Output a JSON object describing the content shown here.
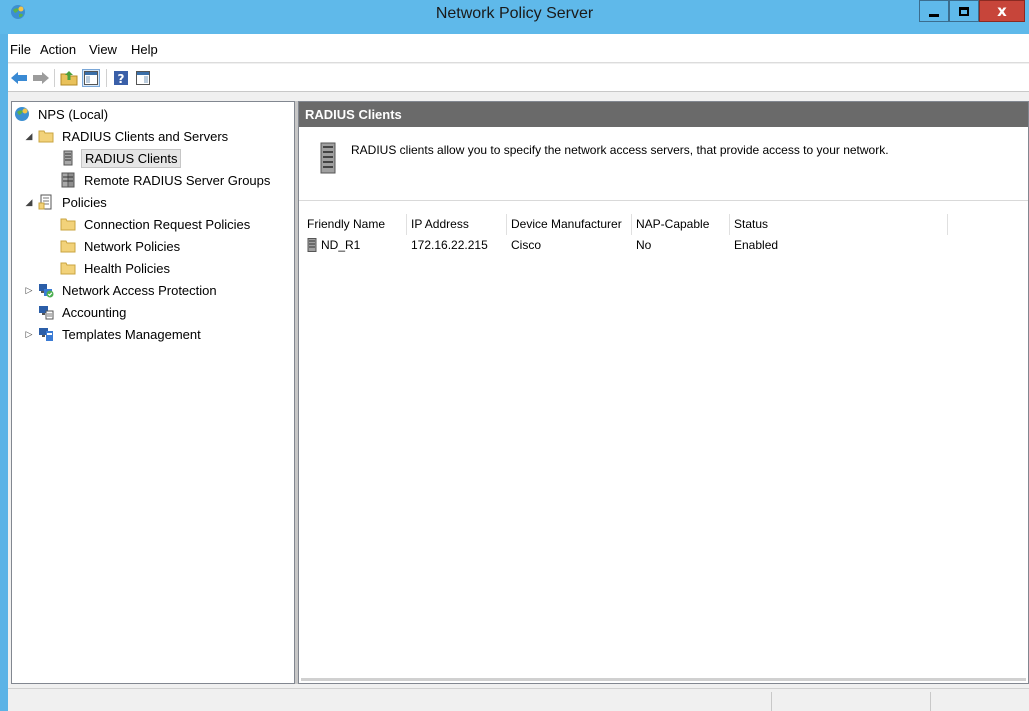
{
  "window": {
    "title": "Network Policy Server"
  },
  "menu": {
    "items": [
      "File",
      "Action",
      "View",
      "Help"
    ]
  },
  "tree": {
    "root": "NPS (Local)",
    "radius_group": "RADIUS Clients and Servers",
    "radius_clients": "RADIUS Clients",
    "remote_groups": "Remote RADIUS Server Groups",
    "policies": "Policies",
    "connection_request": "Connection Request Policies",
    "network_policies": "Network Policies",
    "health_policies": "Health Policies",
    "nap": "Network Access Protection",
    "accounting": "Accounting",
    "templates": "Templates Management"
  },
  "content": {
    "header": "RADIUS Clients",
    "description": "RADIUS clients allow you to specify the network access servers, that provide access to your network."
  },
  "table": {
    "columns": [
      "Friendly Name",
      "IP Address",
      "Device Manufacturer",
      "NAP-Capable",
      "Status"
    ],
    "rows": [
      {
        "friendly_name": "ND_R1",
        "ip_address": "172.16.22.215",
        "manufacturer": "Cisco",
        "nap_capable": "No",
        "status": "Enabled"
      }
    ]
  },
  "colors": {
    "titlebar": "#5fb9ea",
    "header": "#6a6a6a",
    "close": "#c7453a"
  }
}
